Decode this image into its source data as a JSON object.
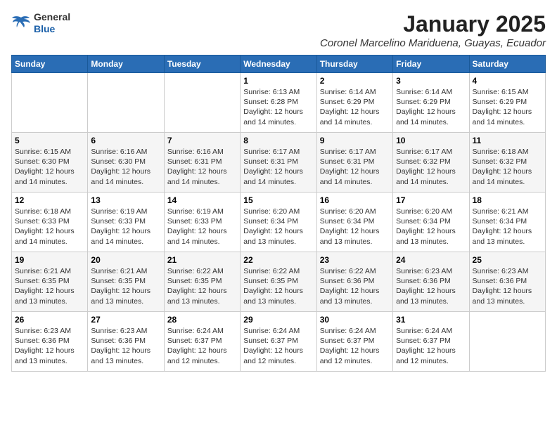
{
  "logo": {
    "line1": "General",
    "line2": "Blue"
  },
  "title": "January 2025",
  "subtitle": "Coronel Marcelino Mariduena, Guayas, Ecuador",
  "weekdays": [
    "Sunday",
    "Monday",
    "Tuesday",
    "Wednesday",
    "Thursday",
    "Friday",
    "Saturday"
  ],
  "weeks": [
    [
      {
        "day": "",
        "info": ""
      },
      {
        "day": "",
        "info": ""
      },
      {
        "day": "",
        "info": ""
      },
      {
        "day": "1",
        "info": "Sunrise: 6:13 AM\nSunset: 6:28 PM\nDaylight: 12 hours\nand 14 minutes."
      },
      {
        "day": "2",
        "info": "Sunrise: 6:14 AM\nSunset: 6:29 PM\nDaylight: 12 hours\nand 14 minutes."
      },
      {
        "day": "3",
        "info": "Sunrise: 6:14 AM\nSunset: 6:29 PM\nDaylight: 12 hours\nand 14 minutes."
      },
      {
        "day": "4",
        "info": "Sunrise: 6:15 AM\nSunset: 6:29 PM\nDaylight: 12 hours\nand 14 minutes."
      }
    ],
    [
      {
        "day": "5",
        "info": "Sunrise: 6:15 AM\nSunset: 6:30 PM\nDaylight: 12 hours\nand 14 minutes."
      },
      {
        "day": "6",
        "info": "Sunrise: 6:16 AM\nSunset: 6:30 PM\nDaylight: 12 hours\nand 14 minutes."
      },
      {
        "day": "7",
        "info": "Sunrise: 6:16 AM\nSunset: 6:31 PM\nDaylight: 12 hours\nand 14 minutes."
      },
      {
        "day": "8",
        "info": "Sunrise: 6:17 AM\nSunset: 6:31 PM\nDaylight: 12 hours\nand 14 minutes."
      },
      {
        "day": "9",
        "info": "Sunrise: 6:17 AM\nSunset: 6:31 PM\nDaylight: 12 hours\nand 14 minutes."
      },
      {
        "day": "10",
        "info": "Sunrise: 6:17 AM\nSunset: 6:32 PM\nDaylight: 12 hours\nand 14 minutes."
      },
      {
        "day": "11",
        "info": "Sunrise: 6:18 AM\nSunset: 6:32 PM\nDaylight: 12 hours\nand 14 minutes."
      }
    ],
    [
      {
        "day": "12",
        "info": "Sunrise: 6:18 AM\nSunset: 6:33 PM\nDaylight: 12 hours\nand 14 minutes."
      },
      {
        "day": "13",
        "info": "Sunrise: 6:19 AM\nSunset: 6:33 PM\nDaylight: 12 hours\nand 14 minutes."
      },
      {
        "day": "14",
        "info": "Sunrise: 6:19 AM\nSunset: 6:33 PM\nDaylight: 12 hours\nand 14 minutes."
      },
      {
        "day": "15",
        "info": "Sunrise: 6:20 AM\nSunset: 6:34 PM\nDaylight: 12 hours\nand 13 minutes."
      },
      {
        "day": "16",
        "info": "Sunrise: 6:20 AM\nSunset: 6:34 PM\nDaylight: 12 hours\nand 13 minutes."
      },
      {
        "day": "17",
        "info": "Sunrise: 6:20 AM\nSunset: 6:34 PM\nDaylight: 12 hours\nand 13 minutes."
      },
      {
        "day": "18",
        "info": "Sunrise: 6:21 AM\nSunset: 6:34 PM\nDaylight: 12 hours\nand 13 minutes."
      }
    ],
    [
      {
        "day": "19",
        "info": "Sunrise: 6:21 AM\nSunset: 6:35 PM\nDaylight: 12 hours\nand 13 minutes."
      },
      {
        "day": "20",
        "info": "Sunrise: 6:21 AM\nSunset: 6:35 PM\nDaylight: 12 hours\nand 13 minutes."
      },
      {
        "day": "21",
        "info": "Sunrise: 6:22 AM\nSunset: 6:35 PM\nDaylight: 12 hours\nand 13 minutes."
      },
      {
        "day": "22",
        "info": "Sunrise: 6:22 AM\nSunset: 6:35 PM\nDaylight: 12 hours\nand 13 minutes."
      },
      {
        "day": "23",
        "info": "Sunrise: 6:22 AM\nSunset: 6:36 PM\nDaylight: 12 hours\nand 13 minutes."
      },
      {
        "day": "24",
        "info": "Sunrise: 6:23 AM\nSunset: 6:36 PM\nDaylight: 12 hours\nand 13 minutes."
      },
      {
        "day": "25",
        "info": "Sunrise: 6:23 AM\nSunset: 6:36 PM\nDaylight: 12 hours\nand 13 minutes."
      }
    ],
    [
      {
        "day": "26",
        "info": "Sunrise: 6:23 AM\nSunset: 6:36 PM\nDaylight: 12 hours\nand 13 minutes."
      },
      {
        "day": "27",
        "info": "Sunrise: 6:23 AM\nSunset: 6:36 PM\nDaylight: 12 hours\nand 13 minutes."
      },
      {
        "day": "28",
        "info": "Sunrise: 6:24 AM\nSunset: 6:37 PM\nDaylight: 12 hours\nand 12 minutes."
      },
      {
        "day": "29",
        "info": "Sunrise: 6:24 AM\nSunset: 6:37 PM\nDaylight: 12 hours\nand 12 minutes."
      },
      {
        "day": "30",
        "info": "Sunrise: 6:24 AM\nSunset: 6:37 PM\nDaylight: 12 hours\nand 12 minutes."
      },
      {
        "day": "31",
        "info": "Sunrise: 6:24 AM\nSunset: 6:37 PM\nDaylight: 12 hours\nand 12 minutes."
      },
      {
        "day": "",
        "info": ""
      }
    ]
  ]
}
